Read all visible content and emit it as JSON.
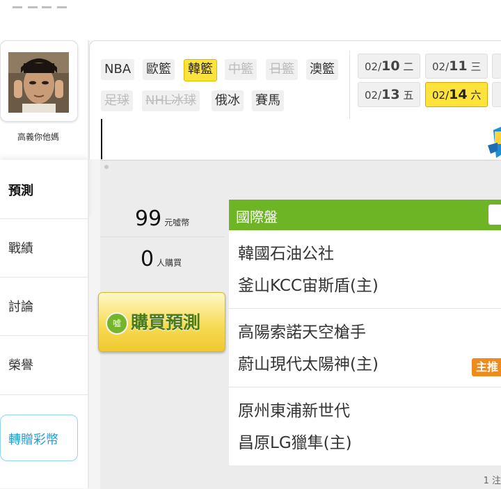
{
  "user": {
    "name": "高義你他媽"
  },
  "nav": {
    "active": "預測",
    "items": [
      "戰績",
      "討論",
      "榮譽"
    ],
    "transfer_button": "轉贈彩幣"
  },
  "leagues": [
    {
      "label": "NBA",
      "state": "normal"
    },
    {
      "label": "歐籃",
      "state": "normal"
    },
    {
      "label": "韓籃",
      "state": "active"
    },
    {
      "label": "中籃",
      "state": "disabled"
    },
    {
      "label": "日籃",
      "state": "disabled"
    },
    {
      "label": "澳籃",
      "state": "normal"
    },
    {
      "label": "足球",
      "state": "disabled"
    },
    {
      "label": "NHL冰球",
      "state": "disabled"
    },
    {
      "label": "俄冰",
      "state": "normal"
    },
    {
      "label": "賽馬",
      "state": "normal"
    }
  ],
  "dates": [
    {
      "md": "02/",
      "day": "10",
      "wd": "二",
      "active": false
    },
    {
      "md": "02/",
      "day": "11",
      "wd": "三",
      "active": false
    },
    {
      "md": "02/",
      "day": "13",
      "wd": "五",
      "active": false
    },
    {
      "md": "02/",
      "day": "14",
      "wd": "六",
      "active": true
    }
  ],
  "stats": {
    "price": "99",
    "price_unit": "元噓幣",
    "buyers": "0",
    "buyers_unit": "人購買"
  },
  "buy": {
    "label": "購買預測",
    "icon_text": "噓"
  },
  "games_header": "國際盤",
  "games": [
    {
      "away": "韓國石油公社",
      "home": "釜山KCC宙斯盾(主)",
      "badge": ""
    },
    {
      "away": "高陽索諾天空槍手",
      "home": "蔚山現代太陽神(主)",
      "badge": "主推"
    },
    {
      "away": "原州東浦新世代",
      "home": "昌原LG獵隼(主)",
      "badge": ""
    }
  ],
  "footer_note": "1 注",
  "colors": {
    "accent_yellow": "#ffe33d",
    "header_green": "#6db524",
    "badge_orange": "#f08a1c",
    "link_blue": "#1aa0d8"
  }
}
